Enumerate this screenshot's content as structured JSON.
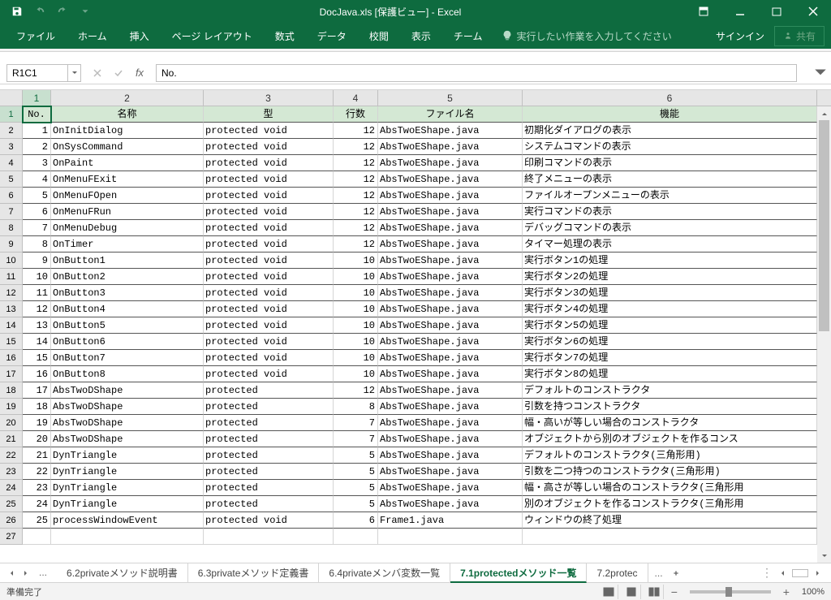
{
  "title": "DocJava.xls  [保護ビュー] - Excel",
  "qat": {
    "save": "save",
    "undo": "undo",
    "redo": "redo"
  },
  "tabs": [
    "ファイル",
    "ホーム",
    "挿入",
    "ページ レイアウト",
    "数式",
    "データ",
    "校閲",
    "表示",
    "チーム"
  ],
  "tell_me": "実行したい作業を入力してください",
  "signin": "サインイン",
  "share": "共有",
  "name_box": "R1C1",
  "formula": "No.",
  "col_labels": [
    "1",
    "2",
    "3",
    "4",
    "5",
    "6"
  ],
  "headers": [
    "No.",
    "名称",
    "型",
    "行数",
    "ファイル名",
    "機能"
  ],
  "rows": [
    {
      "n": "1",
      "name": "OnInitDialog",
      "type": "protected void",
      "lines": "12",
      "file": "AbsTwoEShape.java",
      "func": "初期化ダイアログの表示"
    },
    {
      "n": "2",
      "name": "OnSysCommand",
      "type": "protected void",
      "lines": "12",
      "file": "AbsTwoEShape.java",
      "func": "システムコマンドの表示"
    },
    {
      "n": "3",
      "name": "OnPaint",
      "type": "protected void",
      "lines": "12",
      "file": "AbsTwoEShape.java",
      "func": "印刷コマンドの表示"
    },
    {
      "n": "4",
      "name": "OnMenuFExit",
      "type": "protected void",
      "lines": "12",
      "file": "AbsTwoEShape.java",
      "func": "終了メニューの表示"
    },
    {
      "n": "5",
      "name": "OnMenuFOpen",
      "type": "protected void",
      "lines": "12",
      "file": "AbsTwoEShape.java",
      "func": "ファイルオープンメニューの表示"
    },
    {
      "n": "6",
      "name": "OnMenuFRun",
      "type": "protected void",
      "lines": "12",
      "file": "AbsTwoEShape.java",
      "func": "実行コマンドの表示"
    },
    {
      "n": "7",
      "name": "OnMenuDebug",
      "type": "protected void",
      "lines": "12",
      "file": "AbsTwoEShape.java",
      "func": "デバッグコマンドの表示"
    },
    {
      "n": "8",
      "name": "OnTimer",
      "type": "protected void",
      "lines": "12",
      "file": "AbsTwoEShape.java",
      "func": "タイマー処理の表示"
    },
    {
      "n": "9",
      "name": "OnButton1",
      "type": "protected void",
      "lines": "10",
      "file": "AbsTwoEShape.java",
      "func": "実行ボタン1の処理"
    },
    {
      "n": "10",
      "name": "OnButton2",
      "type": "protected void",
      "lines": "10",
      "file": "AbsTwoEShape.java",
      "func": "実行ボタン2の処理"
    },
    {
      "n": "11",
      "name": "OnButton3",
      "type": "protected void",
      "lines": "10",
      "file": "AbsTwoEShape.java",
      "func": "実行ボタン3の処理"
    },
    {
      "n": "12",
      "name": "OnButton4",
      "type": "protected void",
      "lines": "10",
      "file": "AbsTwoEShape.java",
      "func": "実行ボタン4の処理"
    },
    {
      "n": "13",
      "name": "OnButton5",
      "type": "protected void",
      "lines": "10",
      "file": "AbsTwoEShape.java",
      "func": "実行ボタン5の処理"
    },
    {
      "n": "14",
      "name": "OnButton6",
      "type": "protected void",
      "lines": "10",
      "file": "AbsTwoEShape.java",
      "func": "実行ボタン6の処理"
    },
    {
      "n": "15",
      "name": "OnButton7",
      "type": "protected void",
      "lines": "10",
      "file": "AbsTwoEShape.java",
      "func": "実行ボタン7の処理"
    },
    {
      "n": "16",
      "name": "OnButton8",
      "type": "protected void",
      "lines": "10",
      "file": "AbsTwoEShape.java",
      "func": "実行ボタン8の処理"
    },
    {
      "n": "17",
      "name": "AbsTwoDShape",
      "type": "protected",
      "lines": "12",
      "file": "AbsTwoEShape.java",
      "func": "デフォルトのコンストラクタ"
    },
    {
      "n": "18",
      "name": "AbsTwoDShape",
      "type": "protected",
      "lines": "8",
      "file": "AbsTwoEShape.java",
      "func": "引数を持つコンストラクタ"
    },
    {
      "n": "19",
      "name": "AbsTwoDShape",
      "type": "protected",
      "lines": "7",
      "file": "AbsTwoEShape.java",
      "func": "幅・高いが等しい場合のコンストラクタ"
    },
    {
      "n": "20",
      "name": "AbsTwoDShape",
      "type": "protected",
      "lines": "7",
      "file": "AbsTwoEShape.java",
      "func": "オブジェクトから別のオブジェクトを作るコンス"
    },
    {
      "n": "21",
      "name": "DynTriangle",
      "type": "protected",
      "lines": "5",
      "file": "AbsTwoEShape.java",
      "func": "デフォルトのコンストラクタ(三角形用)"
    },
    {
      "n": "22",
      "name": "DynTriangle",
      "type": "protected",
      "lines": "5",
      "file": "AbsTwoEShape.java",
      "func": "引数を二つ持つのコンストラクタ(三角形用)"
    },
    {
      "n": "23",
      "name": "DynTriangle",
      "type": "protected",
      "lines": "5",
      "file": "AbsTwoEShape.java",
      "func": "幅・高さが等しい場合のコンストラクタ(三角形用"
    },
    {
      "n": "24",
      "name": "DynTriangle",
      "type": "protected",
      "lines": "5",
      "file": "AbsTwoEShape.java",
      "func": "別のオブジェクトを作るコンストラクタ(三角形用"
    },
    {
      "n": "25",
      "name": "processWindowEvent",
      "type": "protected void",
      "lines": "6",
      "file": "Frame1.java",
      "func": "ウィンドウの終了処理"
    }
  ],
  "sheets": [
    "6.2privateメソッド説明書",
    "6.3privateメソッド定義書",
    "6.4privateメンバ変数一覧",
    "7.1protectedメソッド一覧",
    "7.2protec"
  ],
  "active_sheet": 3,
  "status": "準備完了",
  "zoom": "100%"
}
